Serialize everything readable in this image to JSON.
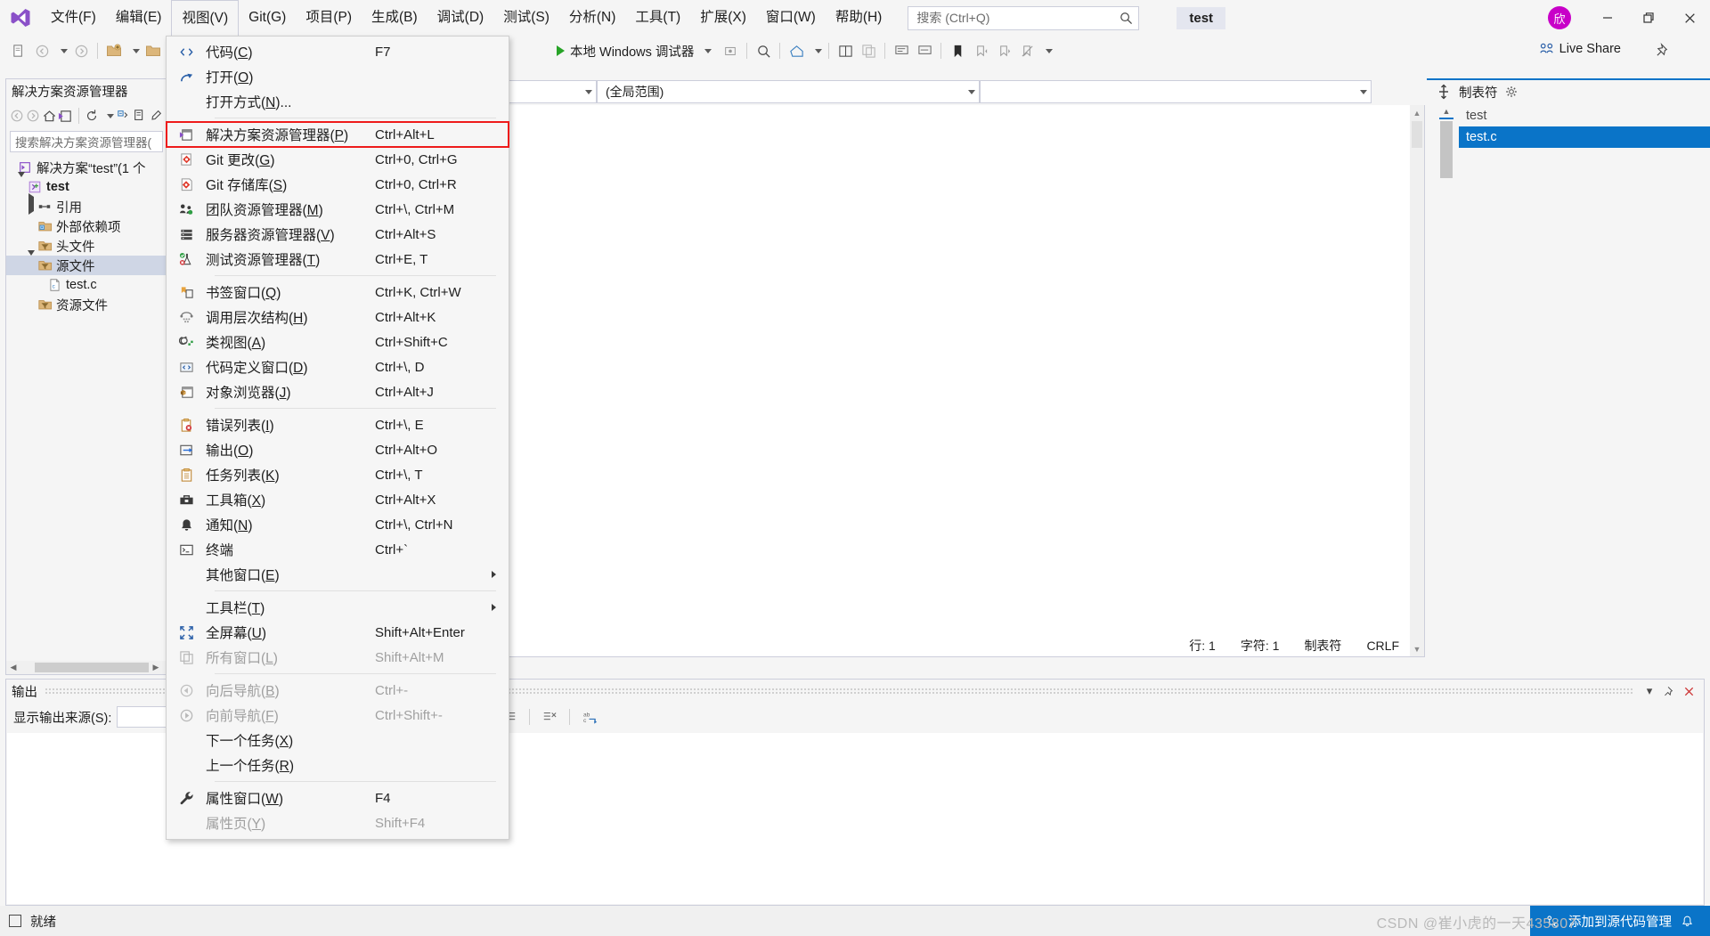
{
  "titlebar": {
    "logo_icon": "visual-studio-logo-icon",
    "menus": [
      {
        "label": "文件(F)"
      },
      {
        "label": "编辑(E)"
      },
      {
        "label": "视图(V)"
      },
      {
        "label": "Git(G)"
      },
      {
        "label": "项目(P)"
      },
      {
        "label": "生成(B)"
      },
      {
        "label": "调试(D)"
      },
      {
        "label": "测试(S)"
      },
      {
        "label": "分析(N)"
      },
      {
        "label": "工具(T)"
      },
      {
        "label": "扩展(X)"
      },
      {
        "label": "窗口(W)"
      },
      {
        "label": "帮助(H)"
      }
    ],
    "search_placeholder": "搜索 (Ctrl+Q)",
    "search_icon": "search-icon",
    "project_title": "test",
    "avatar_text": "欣",
    "minimize_icon": "minimize-icon",
    "maximize_icon": "restore-icon",
    "close_icon": "close-icon"
  },
  "toolbar": {
    "debug_target": "本地 Windows 调试器",
    "live_share": "Live Share",
    "live_share_icon": "live-share-icon",
    "pin_icon": "pin-icon"
  },
  "navbar": {
    "combo_left": "",
    "combo_mid": "(全局范围)",
    "combo_right": ""
  },
  "solution_explorer": {
    "title": "解决方案资源管理器",
    "search_placeholder": "搜索解决方案资源管理器(",
    "toolbar_icons": [
      "back-icon",
      "forward-icon",
      "home-icon",
      "sync-with-active-document-icon",
      "refresh-icon",
      "collapse-all-icon",
      "show-all-files-icon",
      "properties-icon"
    ],
    "tree": [
      {
        "label": "解决方案“test”(1 个",
        "icon": "solution-icon",
        "indent": 0,
        "twisty": "none",
        "bold": false,
        "selected": false
      },
      {
        "label": "test",
        "icon": "cpp-project-icon",
        "indent": 1,
        "twisty": "open",
        "bold": true,
        "selected": false
      },
      {
        "label": "引用",
        "icon": "references-icon",
        "indent": 2,
        "twisty": "closed",
        "bold": false,
        "selected": false
      },
      {
        "label": "外部依赖项",
        "icon": "external-deps-folder-icon",
        "indent": 2,
        "twisty": "none",
        "bold": false,
        "selected": false
      },
      {
        "label": "头文件",
        "icon": "filter-folder-icon",
        "indent": 2,
        "twisty": "none",
        "bold": false,
        "selected": false
      },
      {
        "label": "源文件",
        "icon": "filter-folder-icon",
        "indent": 2,
        "twisty": "open",
        "bold": false,
        "selected": true
      },
      {
        "label": "test.c",
        "icon": "c-file-icon",
        "indent": 3,
        "twisty": "none",
        "bold": false,
        "selected": false
      },
      {
        "label": "资源文件",
        "icon": "filter-folder-icon",
        "indent": 2,
        "twisty": "none",
        "bold": false,
        "selected": false
      }
    ]
  },
  "editor": {
    "status": {
      "line_label": "行: 1",
      "col_label": "字符: 1",
      "tab_label": "制表符",
      "eol_label": "CRLF"
    }
  },
  "tab_well": {
    "title": "制表符",
    "gear_icon": "gear-icon",
    "grip_icon": "dock-grip-icon",
    "items": [
      {
        "label": "test",
        "selected": false
      },
      {
        "label": "test.c",
        "selected": true
      }
    ]
  },
  "output_panel": {
    "title": "输出",
    "source_label": "显示输出来源(S):",
    "source_value": "",
    "buttons": [
      "chevron-down-icon",
      "pin-icon",
      "close-icon"
    ],
    "tool_icons": [
      "indent-icon",
      "outdent-icon",
      "clear-all-icon",
      "word-wrap-icon"
    ]
  },
  "statusbar": {
    "ready_text": "就绪",
    "ready_icon": "stop-square-icon",
    "add_source_text": "添加到源代码管理",
    "source_icon": "source-control-icon",
    "notify_icon": "bell-icon"
  },
  "watermark": {
    "text": "CSDN @崔小虎的一天435807"
  },
  "view_menu": {
    "items": [
      {
        "type": "item",
        "icon": "code-icon",
        "label": "代码(C)",
        "key": "F7",
        "disabled": false,
        "highlight": false
      },
      {
        "type": "item",
        "icon": "open-arrow-icon",
        "label": "打开(O)",
        "key": "",
        "disabled": false,
        "highlight": false
      },
      {
        "type": "item",
        "icon": "none",
        "label": "打开方式(N)...",
        "key": "",
        "disabled": false,
        "highlight": false
      },
      {
        "type": "sep"
      },
      {
        "type": "item",
        "icon": "solution-explorer-icon",
        "label": "解决方案资源管理器(P)",
        "key": "Ctrl+Alt+L",
        "disabled": false,
        "highlight": true
      },
      {
        "type": "item",
        "icon": "git-changes-icon",
        "label": "Git 更改(G)",
        "key": "Ctrl+0, Ctrl+G",
        "disabled": false,
        "highlight": false
      },
      {
        "type": "item",
        "icon": "git-repo-icon",
        "label": "Git 存储库(S)",
        "key": "Ctrl+0, Ctrl+R",
        "disabled": false,
        "highlight": false
      },
      {
        "type": "item",
        "icon": "team-explorer-icon",
        "label": "团队资源管理器(M)",
        "key": "Ctrl+\\, Ctrl+M",
        "disabled": false,
        "highlight": false
      },
      {
        "type": "item",
        "icon": "server-explorer-icon",
        "label": "服务器资源管理器(V)",
        "key": "Ctrl+Alt+S",
        "disabled": false,
        "highlight": false
      },
      {
        "type": "item",
        "icon": "test-explorer-icon",
        "label": "测试资源管理器(T)",
        "key": "Ctrl+E, T",
        "disabled": false,
        "highlight": false
      },
      {
        "type": "sep"
      },
      {
        "type": "item",
        "icon": "bookmark-icon",
        "label": "书签窗口(Q)",
        "key": "Ctrl+K, Ctrl+W",
        "disabled": false,
        "highlight": false
      },
      {
        "type": "item",
        "icon": "call-hierarchy-icon",
        "label": "调用层次结构(H)",
        "key": "Ctrl+Alt+K",
        "disabled": false,
        "highlight": false
      },
      {
        "type": "item",
        "icon": "class-view-icon",
        "label": "类视图(A)",
        "key": "Ctrl+Shift+C",
        "disabled": false,
        "highlight": false
      },
      {
        "type": "item",
        "icon": "code-definition-icon",
        "label": "代码定义窗口(D)",
        "key": "Ctrl+\\, D",
        "disabled": false,
        "highlight": false
      },
      {
        "type": "item",
        "icon": "object-browser-icon",
        "label": "对象浏览器(J)",
        "key": "Ctrl+Alt+J",
        "disabled": false,
        "highlight": false
      },
      {
        "type": "sep"
      },
      {
        "type": "item",
        "icon": "error-list-icon",
        "label": "错误列表(I)",
        "key": "Ctrl+\\, E",
        "disabled": false,
        "highlight": false
      },
      {
        "type": "item",
        "icon": "output-icon",
        "label": "输出(O)",
        "key": "Ctrl+Alt+O",
        "disabled": false,
        "highlight": false
      },
      {
        "type": "item",
        "icon": "task-list-icon",
        "label": "任务列表(K)",
        "key": "Ctrl+\\, T",
        "disabled": false,
        "highlight": false
      },
      {
        "type": "item",
        "icon": "toolbox-icon",
        "label": "工具箱(X)",
        "key": "Ctrl+Alt+X",
        "disabled": false,
        "highlight": false
      },
      {
        "type": "item",
        "icon": "bell-icon",
        "label": "通知(N)",
        "key": "Ctrl+\\, Ctrl+N",
        "disabled": false,
        "highlight": false
      },
      {
        "type": "item",
        "icon": "terminal-icon",
        "label": "终端",
        "key": "Ctrl+`",
        "disabled": false,
        "highlight": false
      },
      {
        "type": "submenu",
        "icon": "none",
        "label": "其他窗口(E)",
        "key": "",
        "disabled": false,
        "highlight": false
      },
      {
        "type": "sep"
      },
      {
        "type": "submenu",
        "icon": "none",
        "label": "工具栏(T)",
        "key": "",
        "disabled": false,
        "highlight": false
      },
      {
        "type": "item",
        "icon": "fullscreen-icon",
        "label": "全屏幕(U)",
        "key": "Shift+Alt+Enter",
        "disabled": false,
        "highlight": false
      },
      {
        "type": "item",
        "icon": "all-windows-icon",
        "label": "所有窗口(L)",
        "key": "Shift+Alt+M",
        "disabled": true,
        "highlight": false
      },
      {
        "type": "sep"
      },
      {
        "type": "item",
        "icon": "nav-back-icon",
        "label": "向后导航(B)",
        "key": "Ctrl+-",
        "disabled": true,
        "highlight": false
      },
      {
        "type": "item",
        "icon": "nav-forward-icon",
        "label": "向前导航(F)",
        "key": "Ctrl+Shift+-",
        "disabled": true,
        "highlight": false
      },
      {
        "type": "item",
        "icon": "none",
        "label": "下一个任务(X)",
        "key": "",
        "disabled": false,
        "highlight": false
      },
      {
        "type": "item",
        "icon": "none",
        "label": "上一个任务(R)",
        "key": "",
        "disabled": false,
        "highlight": false
      },
      {
        "type": "sep"
      },
      {
        "type": "item",
        "icon": "wrench-icon",
        "label": "属性窗口(W)",
        "key": "F4",
        "disabled": false,
        "highlight": false
      },
      {
        "type": "item",
        "icon": "none",
        "label": "属性页(Y)",
        "key": "Shift+F4",
        "disabled": true,
        "highlight": false
      }
    ]
  }
}
